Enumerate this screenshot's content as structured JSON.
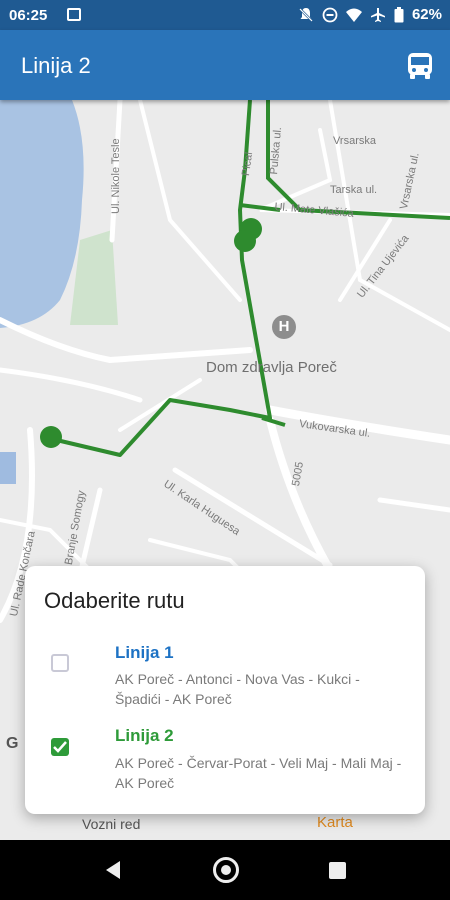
{
  "status_bar": {
    "time": "06:25",
    "battery": "62%",
    "icons": [
      "image-icon",
      "notifications-off-icon",
      "do-not-disturb-icon",
      "wifi-icon",
      "airplane-icon",
      "battery-icon"
    ]
  },
  "app_bar": {
    "title": "Linija 2",
    "action_icon": "bus-icon"
  },
  "map": {
    "streets": [
      "Ul. Nikole Tesle",
      "Pical",
      "Pulska ul.",
      "Vrsarska",
      "Vrsarska ul.",
      "Tarska ul.",
      "Ul. Mate Vlašića",
      "Ul. Tina Ujevića",
      "Vukovarska ul.",
      "5005",
      "Ul. Karla Huguesa",
      "Ul. Rade Končara",
      "Ul. Branje Somogy"
    ],
    "poi": "Dom zdravlja Poreč",
    "google": "G",
    "route_color": "#2e8b2e"
  },
  "bottom_tabs": {
    "timetable": "Vozni red",
    "map": "Karta"
  },
  "dialog": {
    "title": "Odaberite rutu",
    "routes": [
      {
        "name": "Linija 1",
        "description": "AK Poreč - Antonci - Nova Vas - Kukci - Špadići - AK Poreč",
        "checked": false,
        "color": "#1d72c4"
      },
      {
        "name": "Linija 2",
        "description": "AK Poreč - Červar-Porat - Veli Maj - Mali Maj - AK Poreč",
        "checked": true,
        "color": "#2e9b39"
      }
    ]
  }
}
